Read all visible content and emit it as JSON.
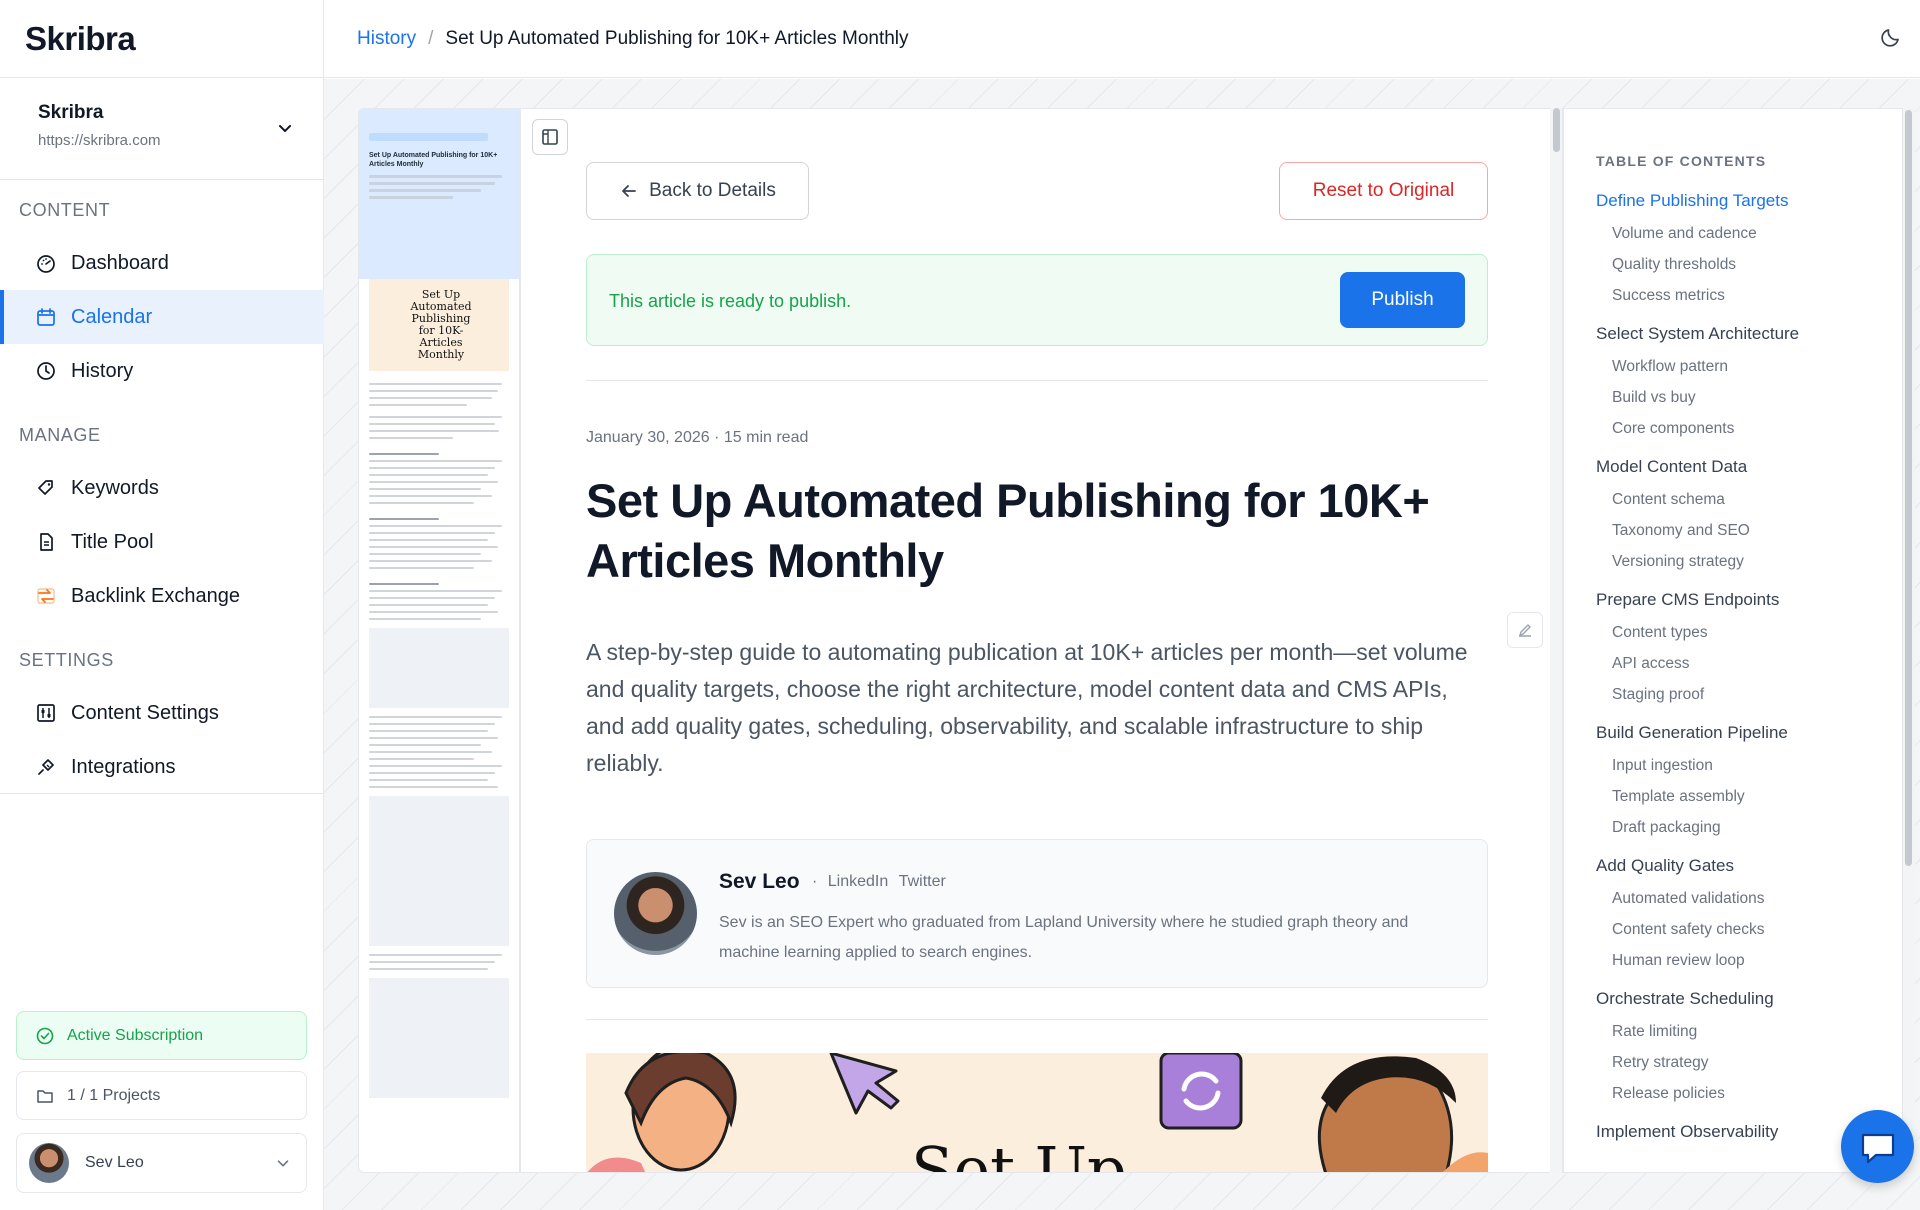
{
  "app": {
    "name": "Skribra"
  },
  "site": {
    "name": "Skribra",
    "url": "https://skribra.com"
  },
  "sidebar": {
    "sections": [
      {
        "label": "CONTENT",
        "items": [
          {
            "label": "Dashboard",
            "icon": "gauge-icon"
          },
          {
            "label": "Calendar",
            "icon": "calendar-icon",
            "active": true
          },
          {
            "label": "History",
            "icon": "clock-icon"
          }
        ]
      },
      {
        "label": "MANAGE",
        "items": [
          {
            "label": "Keywords",
            "icon": "tag-icon"
          },
          {
            "label": "Title Pool",
            "icon": "document-icon"
          },
          {
            "label": "Backlink Exchange",
            "icon": "exchange-icon"
          }
        ]
      },
      {
        "label": "SETTINGS",
        "items": [
          {
            "label": "Content Settings",
            "icon": "sliders-icon"
          },
          {
            "label": "Integrations",
            "icon": "plug-icon"
          }
        ]
      }
    ],
    "subscription": "Active Subscription",
    "projects": "1 / 1 Projects",
    "user": "Sev Leo"
  },
  "breadcrumb": {
    "parent": "History",
    "separator": "/",
    "current": "Set Up Automated Publishing for 10K+ Articles Monthly"
  },
  "article": {
    "back_label": "Back to Details",
    "reset_label": "Reset to Original",
    "ready_text": "This article is ready to publish.",
    "publish_label": "Publish",
    "meta": "January 30, 2026 · 15 min read",
    "title": "Set Up Automated Publishing for 10K+ Articles Monthly",
    "lede": "A step-by-step guide to automating publication at 10K+ articles per month—set volume and quality targets, choose the right architecture, model content data and CMS APIs, and add quality gates, scheduling, observability, and scalable infrastructure to ship reliably.",
    "author": {
      "name": "Sev Leo",
      "links": [
        "LinkedIn",
        "Twitter"
      ],
      "bio": "Sev is an SEO Expert who graduated from Lapland University where he studied graph theory and machine learning applied to search engines."
    },
    "hero_text": "Set Up"
  },
  "thumbnail": {
    "title": "Set Up Automated Publishing for 10K+ Articles Monthly",
    "image_text": "Set Up Automated Publishing for 10K-Articles Monthly"
  },
  "toc": {
    "label": "TABLE OF CONTENTS",
    "sections": [
      {
        "title": "Define Publishing Targets",
        "active": true,
        "items": [
          "Volume and cadence",
          "Quality thresholds",
          "Success metrics"
        ]
      },
      {
        "title": "Select System Architecture",
        "items": [
          "Workflow pattern",
          "Build vs buy",
          "Core components"
        ]
      },
      {
        "title": "Model Content Data",
        "items": [
          "Content schema",
          "Taxonomy and SEO",
          "Versioning strategy"
        ]
      },
      {
        "title": "Prepare CMS Endpoints",
        "items": [
          "Content types",
          "API access",
          "Staging proof"
        ]
      },
      {
        "title": "Build Generation Pipeline",
        "items": [
          "Input ingestion",
          "Template assembly",
          "Draft packaging"
        ]
      },
      {
        "title": "Add Quality Gates",
        "items": [
          "Automated validations",
          "Content safety checks",
          "Human review loop"
        ]
      },
      {
        "title": "Orchestrate Scheduling",
        "items": [
          "Rate limiting",
          "Retry strategy",
          "Release policies"
        ]
      },
      {
        "title": "Implement Observability",
        "items": []
      }
    ]
  },
  "colors": {
    "accent": "#1a73e8",
    "success": "#16a34a",
    "danger": "#dc2626"
  }
}
